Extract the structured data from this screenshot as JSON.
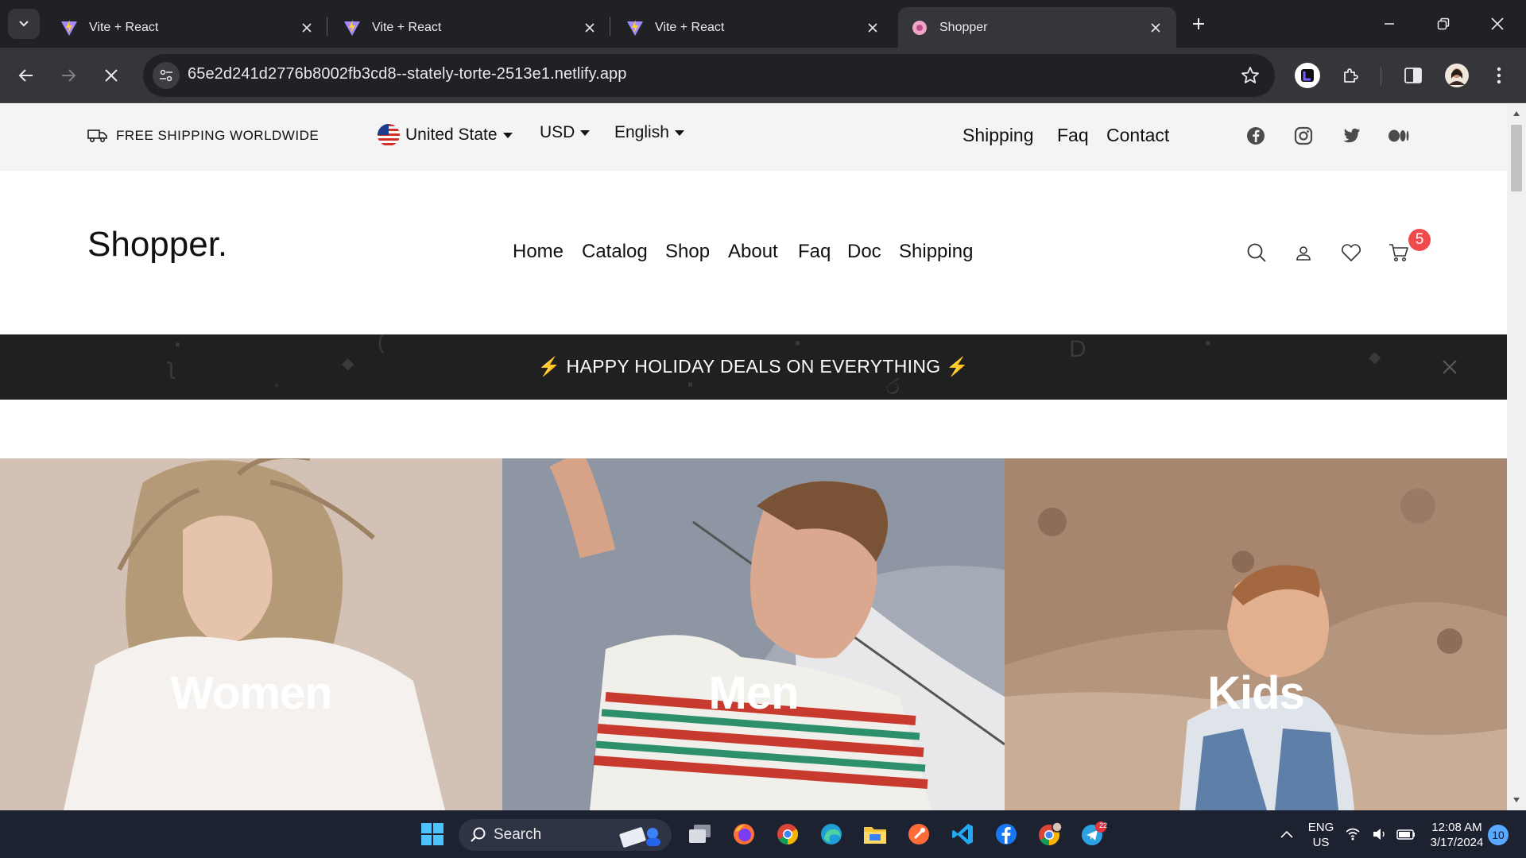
{
  "browser": {
    "tabs": [
      {
        "title": "Vite + React",
        "active": false,
        "icon": "vite-icon"
      },
      {
        "title": "Vite + React",
        "active": false,
        "icon": "vite-icon"
      },
      {
        "title": "Vite + React",
        "active": false,
        "icon": "vite-icon"
      },
      {
        "title": "Shopper",
        "active": true,
        "icon": "shopper-favicon"
      }
    ],
    "url": "65e2d241d2776b8002fb3cd8--stately-torte-2513e1.netlify.app"
  },
  "topbar": {
    "shipping_note": "FREE SHIPPING WORLDWIDE",
    "country": "United State",
    "currency": "USD",
    "language": "English",
    "links": [
      "Shipping",
      "Faq",
      "Contact"
    ],
    "social": [
      "facebook-icon",
      "instagram-icon",
      "twitter-icon",
      "medium-icon"
    ]
  },
  "header": {
    "logo": "Shopper.",
    "nav": [
      "Home",
      "Catalog",
      "Shop",
      "About",
      "Faq",
      "Doc",
      "Shipping"
    ],
    "cart_count": "5"
  },
  "promo": {
    "text": "⚡ HAPPY HOLIDAY DEALS ON EVERYTHING ⚡"
  },
  "categories": [
    {
      "label": "Women"
    },
    {
      "label": "Men"
    },
    {
      "label": "Kids"
    }
  ],
  "taskbar": {
    "search_label": "Search",
    "lang_line1": "ENG",
    "lang_line2": "US",
    "time": "12:08 AM",
    "date": "3/17/2024",
    "notifications": "10",
    "telegram_badge": "22"
  },
  "colors": {
    "promo_bg": "#202020",
    "badge": "#ef4b4b",
    "topbar_bg": "#f4f4f4"
  }
}
